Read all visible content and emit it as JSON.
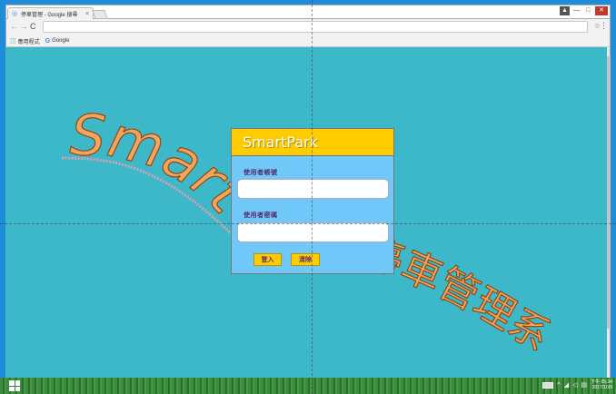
{
  "browser": {
    "tab_title": "停車管理 - Google 搜尋",
    "tab_close": "×",
    "address": "",
    "star": "☆",
    "menu": "⋮",
    "nav": {
      "back": "←",
      "forward": "→",
      "reload": "C"
    },
    "window_controls": {
      "user": "▲",
      "minimize": "—",
      "maximize": "□",
      "close": "✕"
    },
    "bookmarks": [
      {
        "label": "應用程式",
        "icon": "apps-grid-icon"
      },
      {
        "label": "Google",
        "icon": "google-icon",
        "glyph": "G"
      }
    ]
  },
  "background": {
    "logo_text": "SmartPark",
    "tail_text": "停車管理系統",
    "accent_color": "#f5a55b",
    "page_color": "#3db8c9"
  },
  "login": {
    "title": "SmartPark",
    "username_label": "使用者帳號",
    "username_value": "",
    "password_label": "使用者密碼",
    "password_value": "",
    "login_button": "登入",
    "clear_button": "清除",
    "header_color": "#ffcc00",
    "body_color": "#6fc8f8"
  },
  "taskbar": {
    "clock_time": "下午 05:34",
    "clock_date": "2017/10/9"
  }
}
